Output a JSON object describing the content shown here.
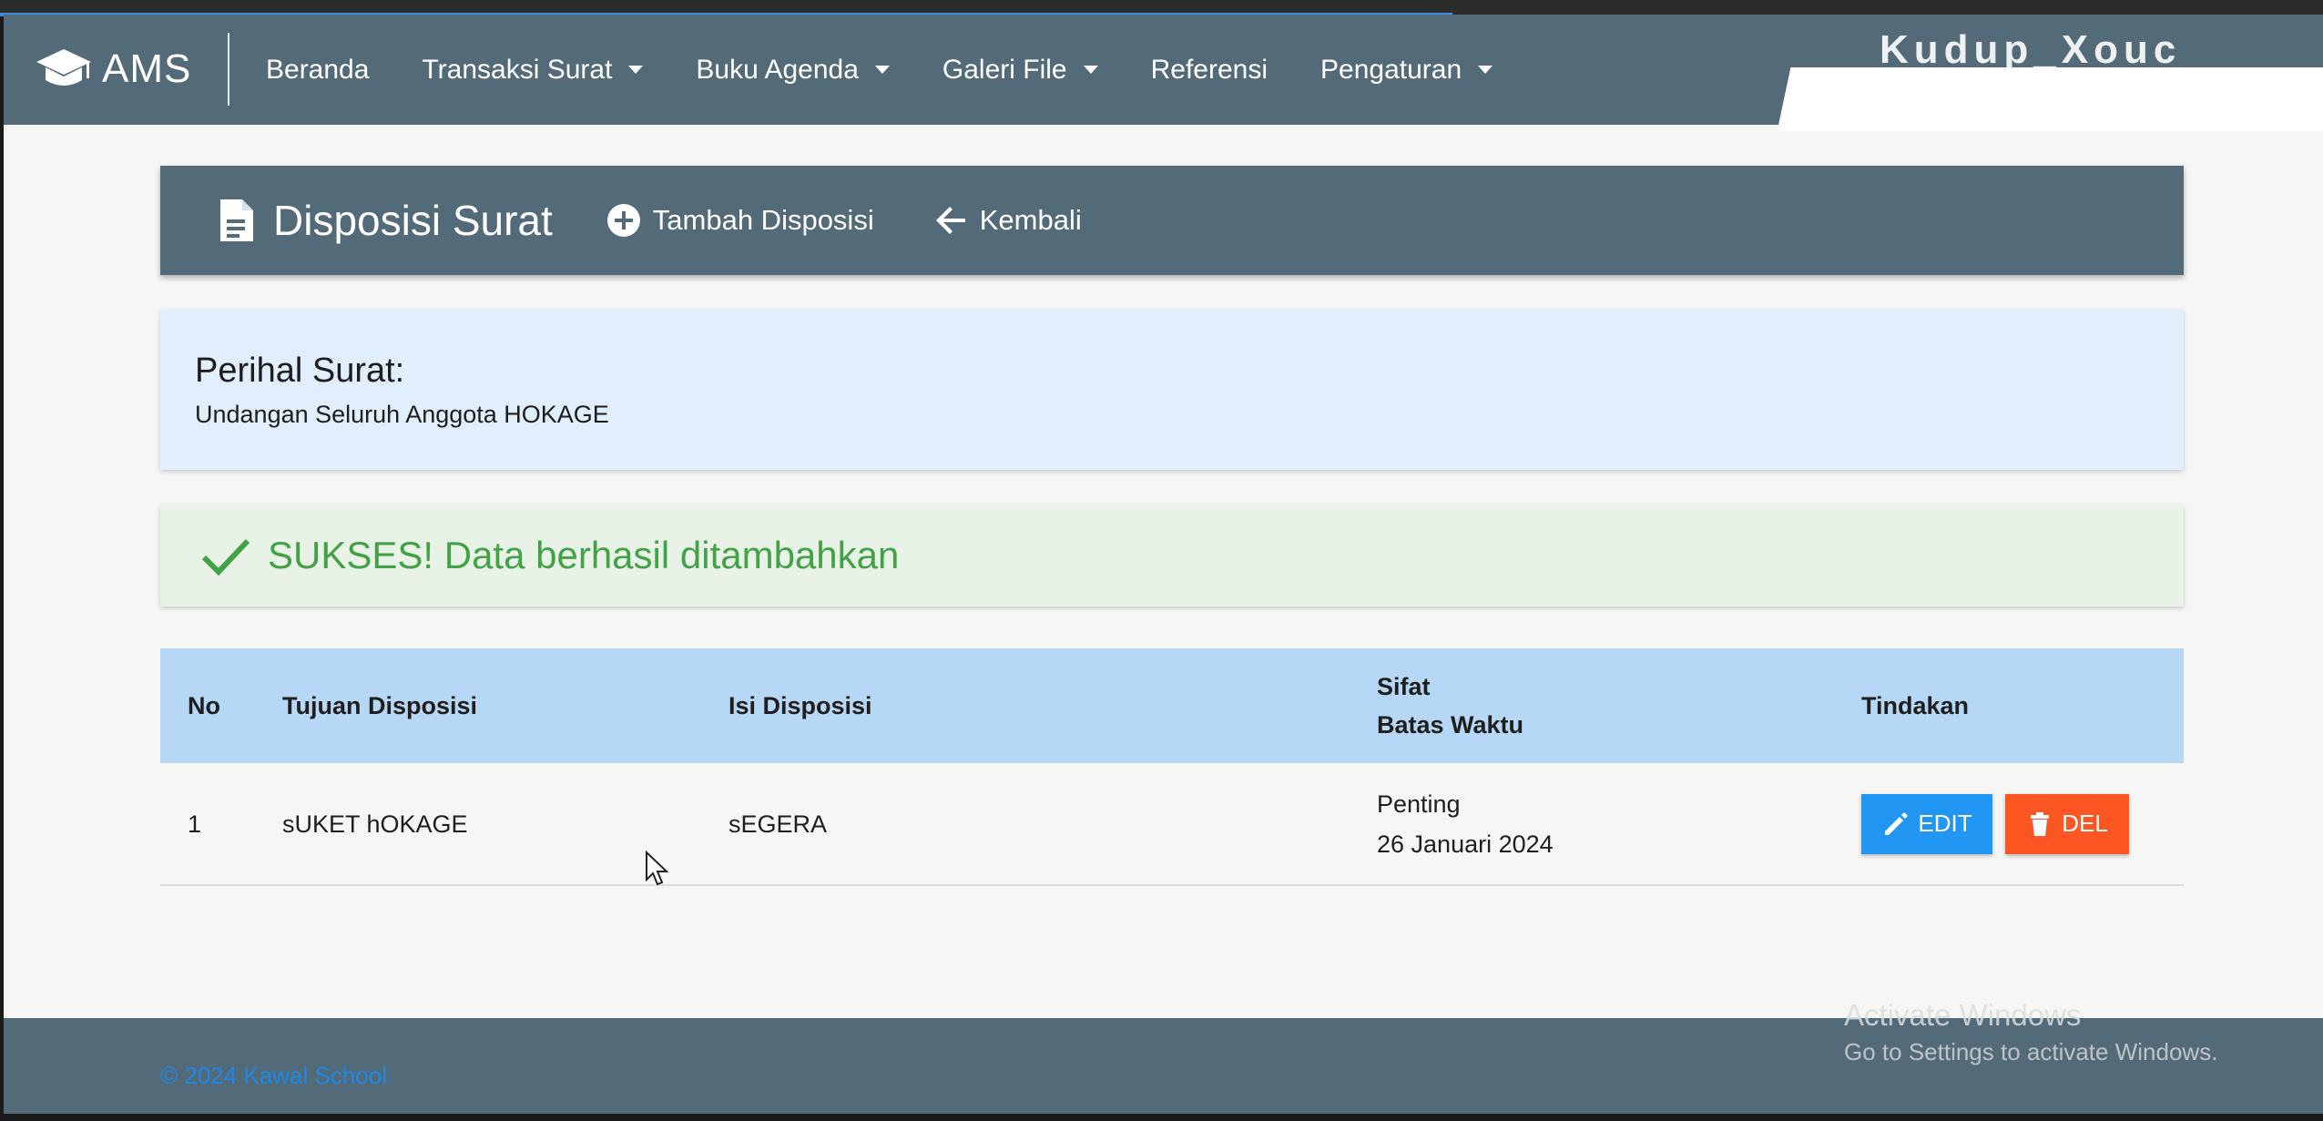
{
  "navbar": {
    "brand": "AMS",
    "items": [
      {
        "label": "Beranda",
        "dropdown": false
      },
      {
        "label": "Transaksi Surat",
        "dropdown": true
      },
      {
        "label": "Buku Agenda",
        "dropdown": true
      },
      {
        "label": "Galeri File",
        "dropdown": true
      },
      {
        "label": "Referensi",
        "dropdown": false
      },
      {
        "label": "Pengaturan",
        "dropdown": true
      }
    ],
    "overlay_text": "Kudup_Xouc"
  },
  "header": {
    "title": "Disposisi Surat",
    "add_label": "Tambah Disposisi",
    "back_label": "Kembali"
  },
  "perihal": {
    "label": "Perihal Surat:",
    "value": "Undangan Seluruh Anggota HOKAGE"
  },
  "alert": {
    "message": "SUKSES! Data berhasil ditambahkan",
    "color": "#43a247"
  },
  "table": {
    "headers": {
      "no": "No",
      "tujuan": "Tujuan Disposisi",
      "isi": "Isi Disposisi",
      "sifat": "Sifat",
      "batas": "Batas Waktu",
      "tindakan": "Tindakan"
    },
    "rows": [
      {
        "no": "1",
        "tujuan": "sUKET hOKAGE",
        "isi": "sEGERA",
        "sifat": "Penting",
        "batas": "26 Januari 2024",
        "edit_label": "EDIT",
        "del_label": "DEL"
      }
    ]
  },
  "footer": {
    "text": "© 2024 Kawal School"
  },
  "watermark": {
    "title": "Activate Windows",
    "subtitle": "Go to Settings to activate Windows."
  },
  "colors": {
    "primary": "#536b79",
    "edit": "#2196f3",
    "delete": "#fc5722",
    "info_bg": "#e1eefc",
    "success_bg": "#e8f2e7",
    "table_head": "#b6d8f6"
  }
}
